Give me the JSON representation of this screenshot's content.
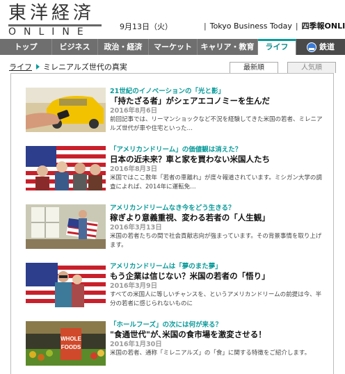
{
  "header": {
    "logo_main": "東洋経済",
    "logo_sub": "ONLINE",
    "date": "9月13日（火）",
    "links": [
      "Tokyo Business Today",
      "四季報ONLINE"
    ]
  },
  "nav": {
    "items": [
      {
        "label": "トップ"
      },
      {
        "label": "ビジネス"
      },
      {
        "label": "政治・経済"
      },
      {
        "label": "マーケット"
      },
      {
        "label": "キャリア・教育"
      },
      {
        "label": "ライフ",
        "active": true
      },
      {
        "label": "鉄道",
        "icon": "train-icon"
      }
    ]
  },
  "breadcrumb": {
    "parent": "ライフ",
    "current": "ミレニアルズ世代の真実"
  },
  "tabs": {
    "latest": "最新順",
    "popular": "人気順"
  },
  "articles": [
    {
      "kicker": "21世紀のイノベーションの「光と影」",
      "title": "「持たざる者」がシェアエコノミーを生んだ",
      "date": "2016年8月6日",
      "summary": "前回記事では、リーマンショックなど不況を経験してきた米国の若者、ミレニアルズ世代が車や住宅といった…",
      "image": "taxi-phone-photo"
    },
    {
      "kicker": "「アメリカンドリーム」の価値観は消えた？",
      "title": "日本の近未来？車と家を買わない米国人たち",
      "date": "2016年8月3日",
      "summary": "米国ではここ数年「若者の車離れ」が度々報道されています。ミシガン大学の調査によれば、2014年に運転免…",
      "image": "flag-group-photo"
    },
    {
      "kicker": "アメリカンドリームなき今をどう生きる？",
      "title": "稼ぎより意義重視、変わる若者の「人生観」",
      "date": "2016年3月13日",
      "summary": "米国の若者たちの間で社会貢献志向が強まっています。その背景事情を取り上げます。",
      "image": "flag-window-photo"
    },
    {
      "kicker": "アメリカンドリームは「夢のまた夢」",
      "title": "もう企業は信じない？米国の若者の「悟り」",
      "date": "2016年3月9日",
      "summary": "すべての米国人に等しいチャンスを、というアメリカンドリームの前提は今、半分の若者に感じられないものに",
      "image": "flag-couple-photo"
    },
    {
      "kicker": "「ホールフーズ」の次には何が来る？",
      "title": "\"食通世代\"が､米国の食市場を激変させる！",
      "date": "2016年1月30日",
      "summary": "米国の若者、通称「ミレニアルズ」の「食」に関する特徴をご紹介します。",
      "image": "whole-foods-photo",
      "sign_text": "WHOLE FOODS"
    }
  ]
}
